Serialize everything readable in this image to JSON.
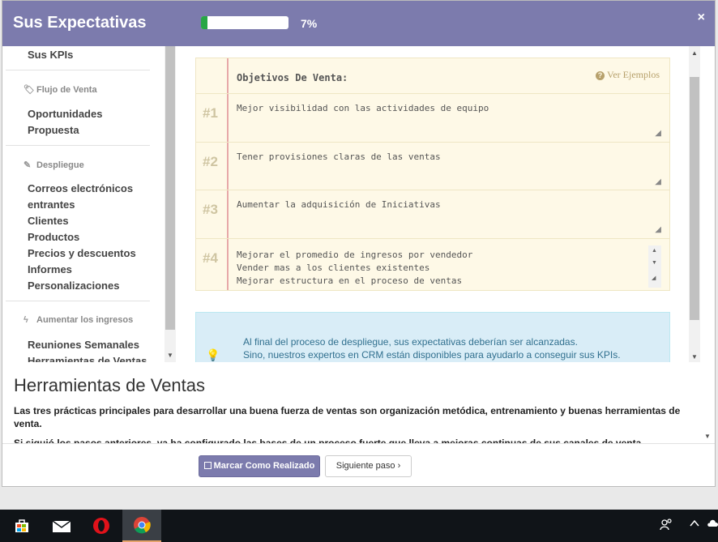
{
  "header": {
    "title": "Sus Expectativas",
    "progress_percent": 7,
    "progress_label": "7%",
    "close_glyph": "×"
  },
  "sidebar": {
    "kpis": "Sus KPIs",
    "flujo_head": "Flujo de Venta",
    "flujo_items": [
      "Oportunidades",
      "Propuesta"
    ],
    "despliegue_head": "Despliegue",
    "despliegue_items": [
      "Correos electrónicos",
      "entrantes",
      "Clientes",
      "Productos",
      "Precios y descuentos",
      "Informes",
      "Personalizaciones"
    ],
    "ingresos_head": "Aumentar los ingresos",
    "ingresos_items": [
      "Reuniones Semanales",
      "Herramientas de Ventas"
    ]
  },
  "notepad": {
    "title": "Objetivos De Venta:",
    "examples_link": "Ver Ejemplos",
    "rows": [
      {
        "num": "#1",
        "text": "Mejor visibilidad con las actividades de equipo"
      },
      {
        "num": "#2",
        "text": "Tener provisiones claras de las ventas"
      },
      {
        "num": "#3",
        "text": "Aumentar la adquisición de Iniciativas"
      },
      {
        "num": "#4",
        "text": "Mejorar el promedio de ingresos por vendedor\nVender mas a los clientes existentes\nMejorar estructura en el proceso de ventas"
      }
    ]
  },
  "tip": {
    "line1": "Al final del proceso de despliegue, sus expectativas deberían ser alcanzadas.",
    "line2": "Sino, nuestros expertos en CRM están disponibles para ayudarlo a conseguir sus KPIs."
  },
  "description": {
    "heading": "Herramientas de Ventas",
    "p1": "Las tres prácticas principales para desarrollar una buena fuerza de ventas son organización metódica, entrenamiento y buenas herramientas de venta.",
    "p2": "Si siguió los pasos anteriores, ya ha configurado las bases de un proceso fuerte que lleva a mejoras continuas de sus canales de venta."
  },
  "footer": {
    "done_label": "Marcar Como Realizado",
    "next_label": "Siguiente paso ›"
  },
  "colors": {
    "accent": "#7c7bad",
    "progress": "#28a745",
    "notepad_bg": "#fef9e7",
    "tip_bg": "#d9edf7"
  }
}
